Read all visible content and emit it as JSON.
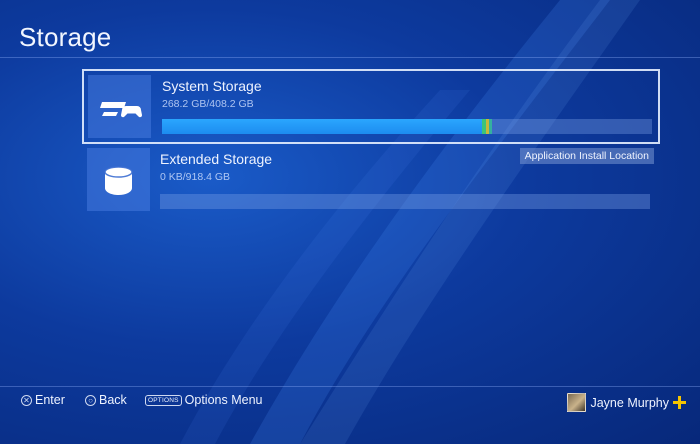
{
  "header": {
    "title": "Storage"
  },
  "rows": [
    {
      "name": "System Storage",
      "size": "268.2 GB/408.2 GB",
      "used_fraction": 0.657,
      "icon": "console-controller-icon",
      "selected": true
    },
    {
      "name": "Extended Storage",
      "size": "0 KB/918.4 GB",
      "used_fraction": 0,
      "icon": "disk-drive-icon",
      "badge": "Application Install Location"
    }
  ],
  "footer": {
    "enter_label": "Enter",
    "back_label": "Back",
    "options_key": "OPTIONS",
    "options_label": "Options Menu"
  },
  "user": {
    "name": "Jayne Murphy",
    "plus_color": "#f5c400"
  },
  "colors": {
    "bar_fill": "#2aa6ff",
    "background": "#0d3a9e"
  }
}
